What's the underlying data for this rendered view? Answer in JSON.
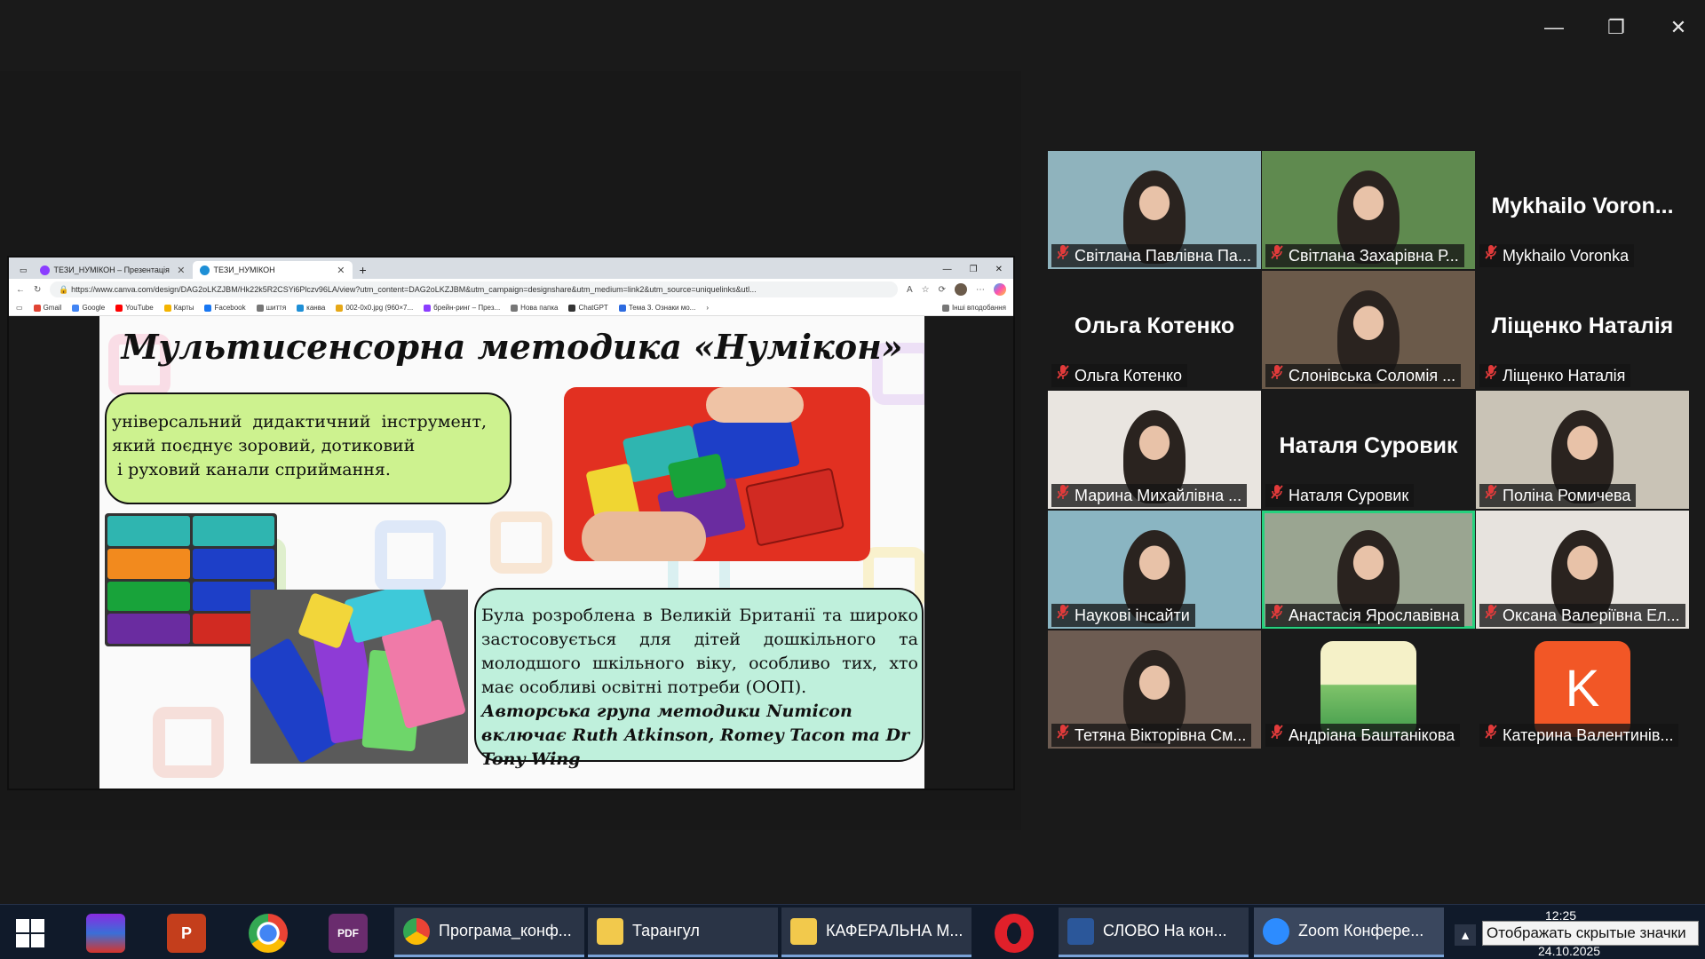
{
  "window": {
    "min": "—",
    "max": "❐",
    "close": "✕"
  },
  "browser": {
    "tabs": [
      {
        "label": "ТЕЗИ_НУМІКОН – Презентація",
        "close": "✕"
      },
      {
        "label": "ТЕЗИ_НУМІКОН",
        "close": "✕"
      }
    ],
    "new_tab": "+",
    "url": "https://www.canva.com/design/DAG2oLKZJBM/Hk22k5R2CSYi6Plczv96LA/view?utm_content=DAG2oLKZJBM&utm_campaign=designshare&utm_medium=link2&utm_source=uniquelinks&utl...",
    "bookmarks": [
      "Gmail",
      "Google",
      "YouTube",
      "Карты",
      "Facebook",
      "шиття",
      "канва",
      "002-0x0.jpg (960×7...",
      "брейн-ринг – През...",
      "Нова папка",
      "ChatGPT",
      "Тема 3. Ознаки мо..."
    ],
    "bookmarks_other": "Інші вподобання"
  },
  "slide": {
    "title": "Мультисенсорна методика «Нумікон»",
    "box1_lines": [
      "універсальний  дидактичний  інструмент,",
      "який поєднує зоровий, дотиковий",
      " і руховий канали сприймання."
    ],
    "box2_text": "Була розроблена в Великій Британії та широко застосовується для дітей дошкільного та молодшого шкільного віку, особливо тих, хто має особливі освітні потреби (ООП).",
    "box2_authors": "Авторська група методики Numicon включає Ruth Atkinson, Romey Tacon та Dr Tony Wing"
  },
  "participants": [
    {
      "big": "",
      "name": "Світлана Павлівна Па..."
    },
    {
      "big": "",
      "name": "Світлана Захарівна Р..."
    },
    {
      "big": "Mykhailo  Voron...",
      "name": "Mykhailo Voronka"
    },
    {
      "big": "Ольга Котенко",
      "name": "Ольга Котенко"
    },
    {
      "big": "",
      "name": "Слонівська Соломія ..."
    },
    {
      "big": "Ліщенко Наталія",
      "name": "Ліщенко Наталія"
    },
    {
      "big": "",
      "name": "Марина Михайлівна ..."
    },
    {
      "big": "Наталя Суровик",
      "name": "Наталя Суровик"
    },
    {
      "big": "",
      "name": "Поліна Ромичева"
    },
    {
      "big": "",
      "name": "Наукові інсайти"
    },
    {
      "big": "",
      "name": "Анастасія Ярославівна"
    },
    {
      "big": "",
      "name": "Оксана Валеріївна Ел..."
    },
    {
      "big": "",
      "name": "Тетяна Вікторівна См..."
    },
    {
      "big": "",
      "name": "Андріана Баштанікова"
    },
    {
      "big": "",
      "name": "Катерина Валентинів..."
    }
  ],
  "avatar_letter": "K",
  "taskbar": {
    "apps": [
      "Програма_конф...",
      "Тарангул",
      "КАФЕРАЛЬНА М...",
      "СЛОВО На кон...",
      "Zoom Конфере..."
    ],
    "tooltip": "Отображать скрытые значки",
    "time": "12:25",
    "date": "24.10.2025"
  },
  "colors": {
    "active_speaker": "#27d17e",
    "muted_mic": "#e23b3b",
    "zoom_blue": "#2d8cff"
  }
}
